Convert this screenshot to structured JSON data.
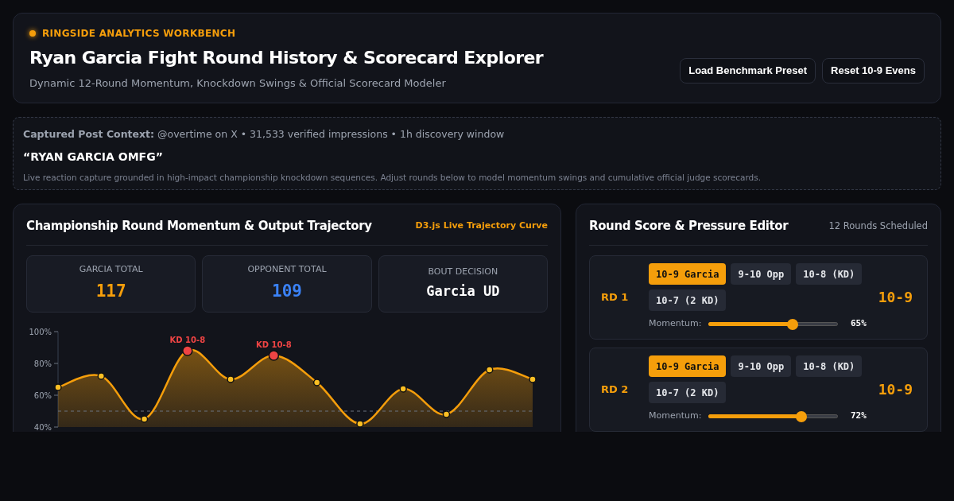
{
  "header": {
    "eyebrow": "RINGSIDE ANALYTICS WORKBENCH",
    "title": "Ryan Garcia Fight Round History & Scorecard Explorer",
    "subtitle": "Dynamic 12-Round Momentum, Knockdown Swings & Official Scorecard Modeler",
    "buttons": [
      "Load Benchmark Preset",
      "Reset 10-9 Evens"
    ]
  },
  "context": {
    "label": "Captured Post Context:",
    "meta": "@overtime on X • 31,533 verified impressions • 1h discovery window",
    "quote": "“RYAN GARCIA OMFG”",
    "note": "Live reaction capture grounded in high-impact championship knockdown sequences. Adjust rounds below to model momentum swings and cumulative official judge scorecards."
  },
  "trajectory": {
    "title": "Championship Round Momentum & Output Trajectory",
    "badge": "D3.js Live Trajectory Curve",
    "stats": [
      {
        "label": "GARCIA TOTAL",
        "value": "117",
        "kind": "garcia"
      },
      {
        "label": "OPPONENT TOTAL",
        "value": "109",
        "kind": "opponent"
      },
      {
        "label": "BOUT DECISION",
        "value": "Garcia UD",
        "kind": "decision"
      }
    ],
    "chart_data": {
      "type": "area",
      "ylim": [
        40,
        100
      ],
      "yticks": [
        {
          "value": 100,
          "label": "100%"
        },
        {
          "value": 80,
          "label": "80%"
        },
        {
          "value": 60,
          "label": "60%"
        },
        {
          "value": 40,
          "label": "40%"
        }
      ],
      "series": [
        {
          "color": "#f59e0b",
          "values": [
            65,
            72,
            45,
            88,
            70,
            85,
            68,
            42,
            64,
            48,
            76,
            70
          ]
        }
      ],
      "ref_lines": [
        {
          "axis": "y",
          "value": 50
        }
      ],
      "annotations": [
        {
          "y": 88,
          "text": "KD 10-8"
        },
        {
          "y": 85,
          "text": "KD 10-8"
        }
      ]
    }
  },
  "editor": {
    "title": "Round Score & Pressure Editor",
    "count": "12 Rounds Scheduled",
    "rounds": [
      {
        "label": "RD 1",
        "options": [
          {
            "label": "10-9 Garcia",
            "selected": true
          },
          {
            "label": "9-10 Opp",
            "selected": false
          },
          {
            "label": "10-8 (KD)",
            "selected": false
          },
          {
            "label": "10-7 (2 KD)",
            "selected": false
          }
        ],
        "score": "10-9",
        "momentum_label": "Momentum:",
        "level": 0.65,
        "reading": "65%"
      },
      {
        "label": "RD 2",
        "options": [
          {
            "label": "10-9 Garcia",
            "selected": true
          },
          {
            "label": "9-10 Opp",
            "selected": false
          },
          {
            "label": "10-8 (KD)",
            "selected": false
          },
          {
            "label": "10-7 (2 KD)",
            "selected": false
          }
        ],
        "score": "10-9",
        "momentum_label": "Momentum:",
        "level": 0.72,
        "reading": "72%"
      }
    ]
  }
}
